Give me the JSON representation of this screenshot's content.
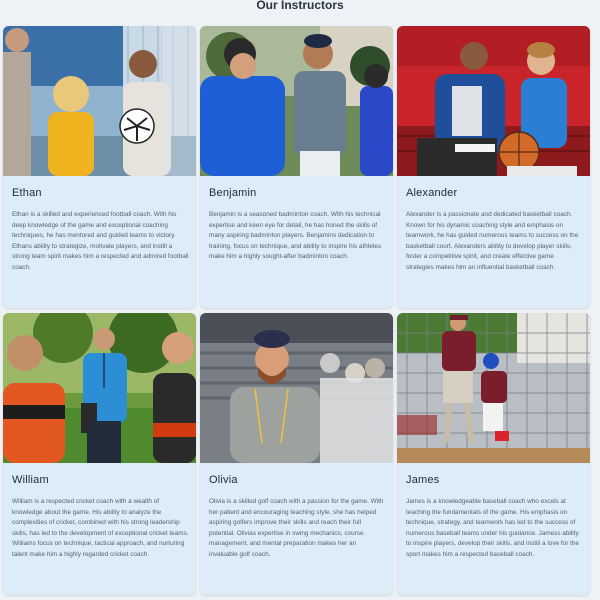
{
  "section_title": "Our Instructors",
  "instructors": [
    {
      "name": "Ethan",
      "photo_icon": "football-coach-photo",
      "bio": "Ethan is a skilled and experienced football coach. With his deep knowledge of the game and exceptional coaching techniques, he has mentored and guided teams to victory. Ethans ability to strategize, motivate players, and instill a strong team spirit makes him a respected and admired football coach."
    },
    {
      "name": "Benjamin",
      "photo_icon": "badminton-coach-photo",
      "bio": "Benjamin is a seasoned badminton coach. With his technical expertise and keen eye for detail, he has honed the skills of many aspiring badminton players. Benjamins dedication to training, focus on technique, and ability to inspire his athletes make him a highly sought-after badminton coach."
    },
    {
      "name": "Alexander",
      "photo_icon": "basketball-coach-photo",
      "bio": "Alexander is a passionate and dedicated basketball coach. Known for his dynamic coaching style and emphasis on teamwork, he has guided numerous teams to success on the basketball court. Alexanders ability to develop player skills, foster a competitive spirit, and create effective game strategies makes him an influential basketball coach."
    },
    {
      "name": "William",
      "photo_icon": "cricket-coach-photo",
      "bio": "William is a respected cricket coach with a wealth of knowledge about the game. His ability to analyze the complexities of cricket, combined with his strong leadership skills, has led to the development of exceptional cricket teams. Williams focus on technique, tactical approach, and nurturing talent make him a highly regarded cricket coach."
    },
    {
      "name": "Olivia",
      "photo_icon": "golf-coach-photo",
      "bio": "Olivia is a skilled golf coach with a passion for the game. With her patient and encouraging teaching style, she has helped aspiring golfers improve their skills and reach their full potential. Olivias expertise in swing mechanics, course management, and mental preparation makes her an invaluable golf coach."
    },
    {
      "name": "James",
      "photo_icon": "baseball-coach-photo",
      "bio": "James is a knowledgeable baseball coach who excels at teaching the fundamentals of the game. His emphasis on technique, strategy, and teamwork has led to the success of numerous baseball teams under his guidance. Jamess ability to inspire players, develop their skills, and instill a love for the sport makes him a respected baseball coach."
    }
  ]
}
